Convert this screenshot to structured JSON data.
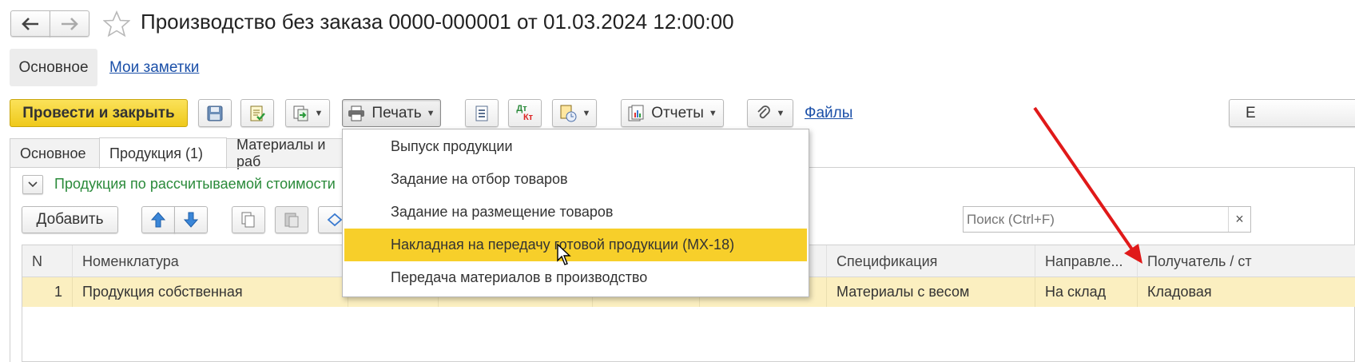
{
  "header": {
    "title": "Производство без заказа 0000-000001 от 01.03.2024 12:00:00"
  },
  "nav": {
    "main_label": "Основное",
    "notes_link": "Мои заметки"
  },
  "toolbar": {
    "post_close_label": "Провести и закрыть",
    "print_label": "Печать",
    "dt_label": "Дт",
    "kt_label": "Кт",
    "reports_label": "Отчеты",
    "files_link": "Файлы",
    "partial_right_label": "Е"
  },
  "tabs": [
    {
      "label": "Основное"
    },
    {
      "label": "Продукция (1)"
    },
    {
      "label": "Материалы и раб"
    }
  ],
  "section": {
    "label": "Продукция по рассчитываемой стоимости"
  },
  "table_toolbar": {
    "add_label": "Добавить"
  },
  "search": {
    "placeholder": "Поиск (Ctrl+F)",
    "clear": "×"
  },
  "table": {
    "headers": [
      "N",
      "Номенклатура",
      "Спецификация",
      "Направле...",
      "Получатель / ст"
    ],
    "row": {
      "n": "1",
      "item": "Продукция собственная",
      "spec": "Материалы с весом",
      "direction": "На склад",
      "recipient": "Кладовая"
    }
  },
  "print_menu": {
    "items": [
      "Выпуск продукции",
      "Задание на отбор товаров",
      "Задание на размещение товаров",
      "Накладная на передачу готовой продукции (МХ-18)",
      "Передача материалов в производство"
    ],
    "highlighted_index": 3
  },
  "colors": {
    "accent_yellow": "#f5d52b",
    "highlight": "#f7cf2a",
    "row_selected": "#fbefc0",
    "link": "#1a4fa8",
    "section_green": "#2a8a3a",
    "arrow_red": "#e01919"
  }
}
